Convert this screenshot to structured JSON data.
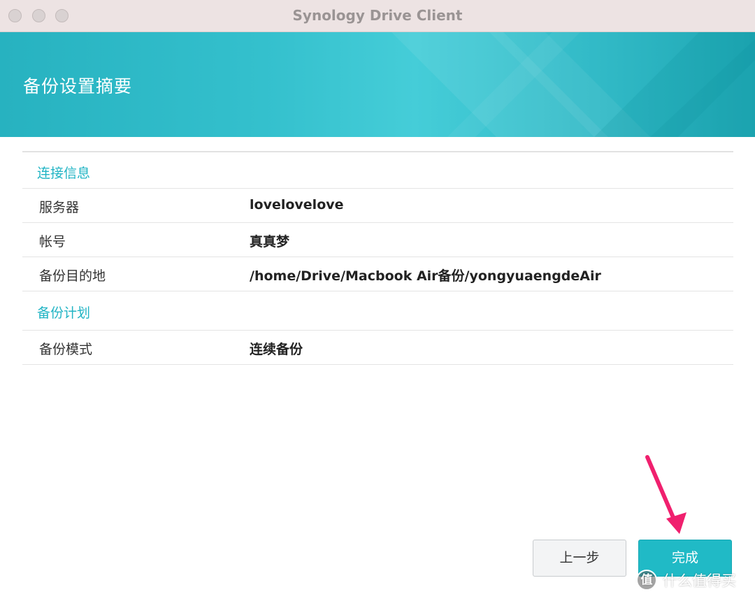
{
  "window": {
    "title": "Synology Drive Client"
  },
  "banner": {
    "title": "备份设置摘要"
  },
  "summary": {
    "connection_section": "连接信息",
    "connection_rows": [
      {
        "label": "服务器",
        "value": "lovelovelove"
      },
      {
        "label": "帐号",
        "value": "真真梦"
      },
      {
        "label": "备份目的地",
        "value": "/home/Drive/Macbook Air备份/yongyuaengdeAir"
      }
    ],
    "plan_section": "备份计划",
    "plan_rows": [
      {
        "label": "备份模式",
        "value": "连续备份"
      }
    ]
  },
  "footer": {
    "prev_label": "上一步",
    "finish_label": "完成"
  },
  "watermark": {
    "badge": "值",
    "text": "什么值得买"
  },
  "colors": {
    "accent": "#21b4c4",
    "finish_button": "#20bac6",
    "annotation_arrow": "#f0206e"
  }
}
